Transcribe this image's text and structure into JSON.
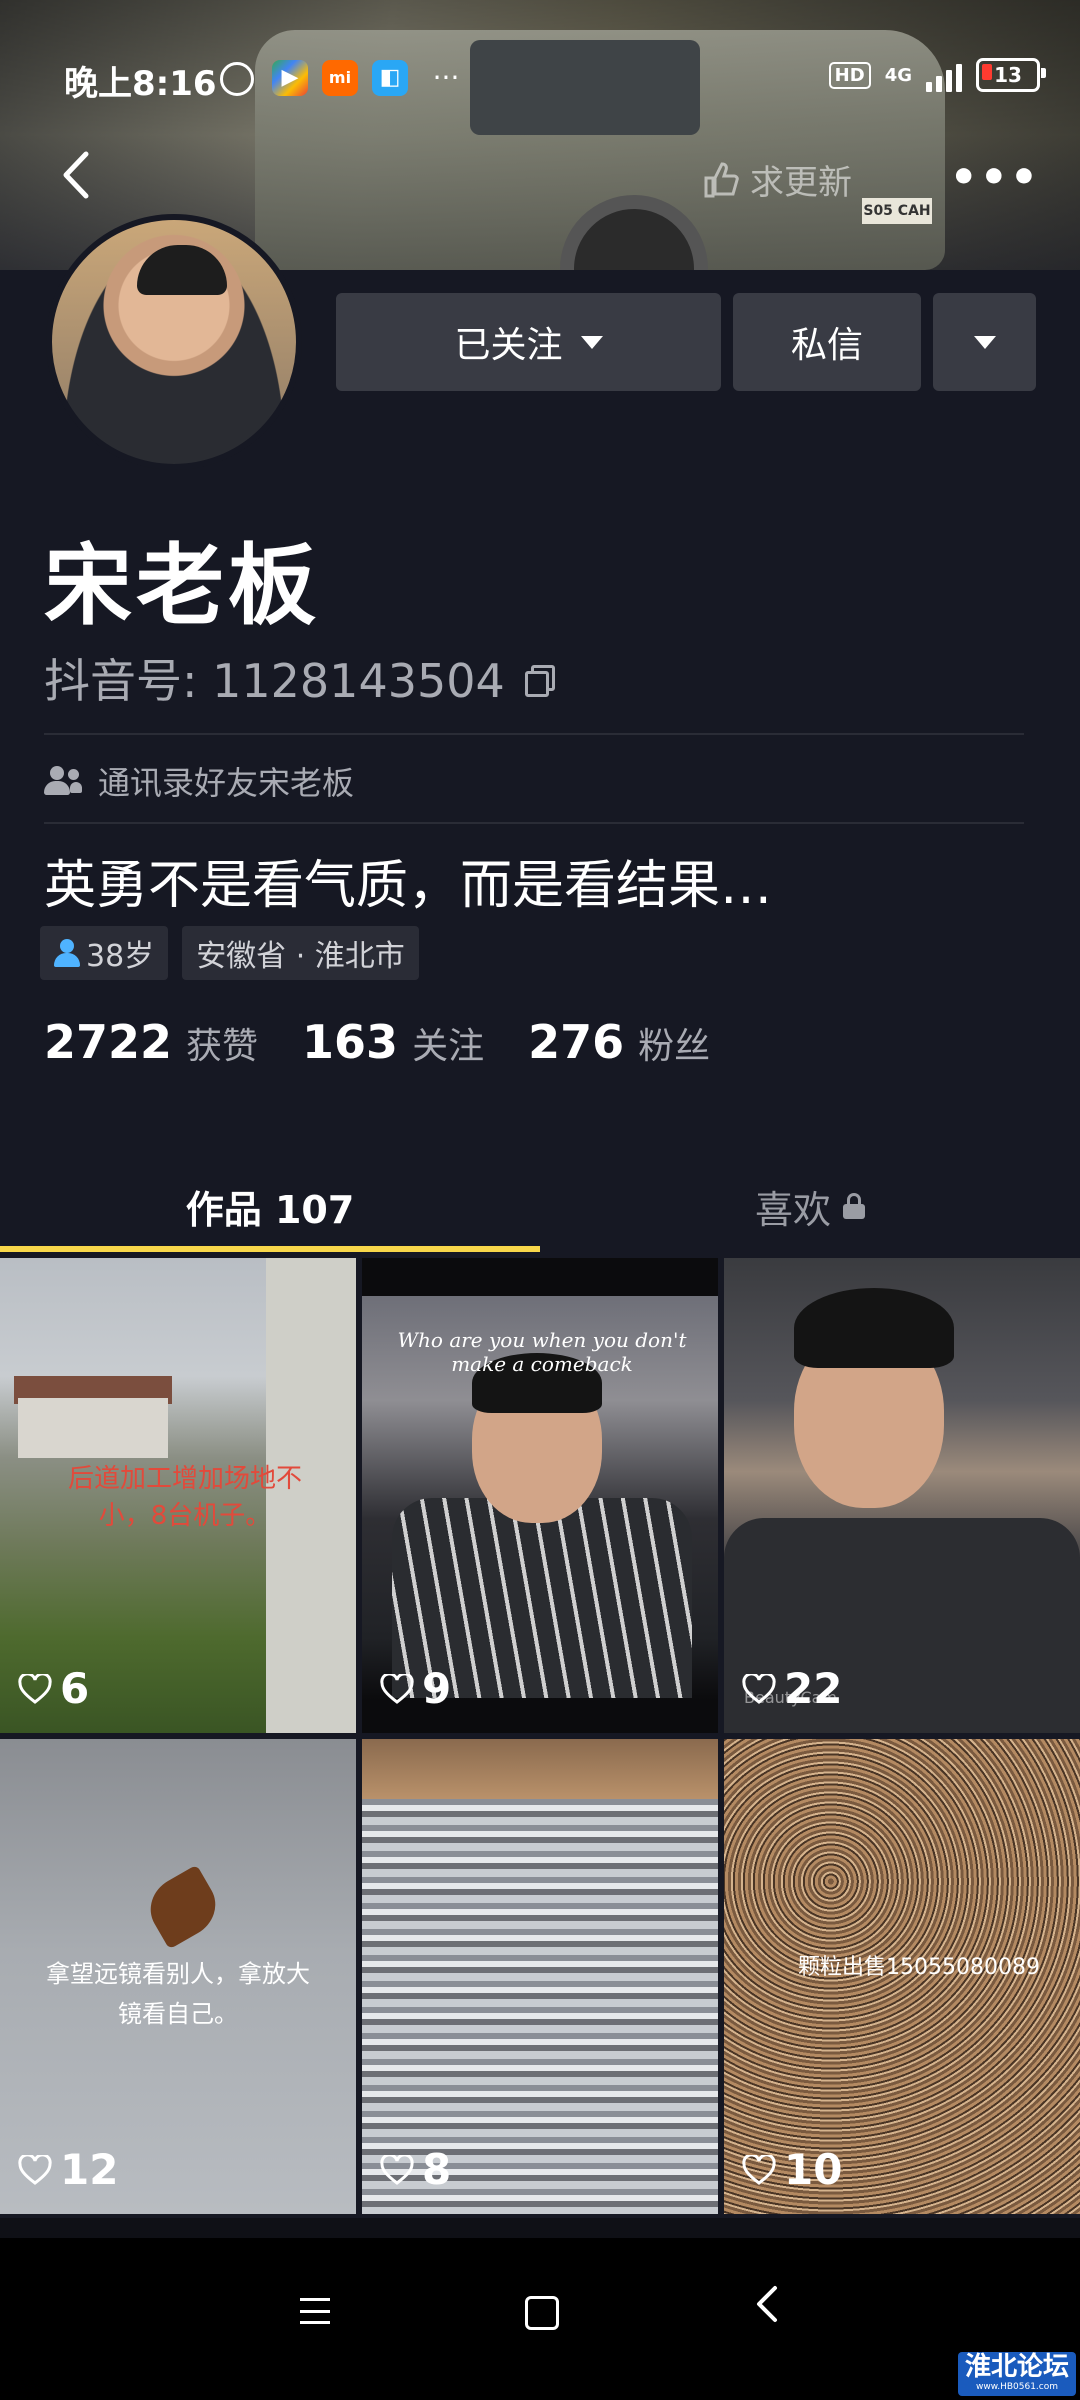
{
  "status_bar": {
    "time": "晚上8:16",
    "network": "4G",
    "hd": "HD",
    "battery": "13"
  },
  "header": {
    "update_label": "求更新"
  },
  "profile": {
    "name": "宋老板",
    "douyin_id": "抖音号: 1128143504",
    "friend_note": "通讯录好友宋老板",
    "bio": "英勇不是看气质，而是看结果…",
    "tags": [
      "38岁",
      "安徽省 · 淮北市"
    ]
  },
  "actions": {
    "follow_label": "已关注",
    "message_label": "私信"
  },
  "stats": [
    {
      "value": "2722",
      "label": "获赞"
    },
    {
      "value": "163",
      "label": "关注"
    },
    {
      "value": "276",
      "label": "粉丝"
    }
  ],
  "tabs": {
    "works": "作品 107",
    "likes": "喜欢"
  },
  "videos": [
    {
      "likes": "6",
      "overlay": "后道加工增加场地不小，8台机子。"
    },
    {
      "likes": "9",
      "overlay": "Who are you when you don't make a comeback"
    },
    {
      "likes": "22",
      "overlay": "BeautyCam"
    },
    {
      "likes": "12",
      "overlay": "拿望远镜看别人，拿放大镜看自己。"
    },
    {
      "likes": "8",
      "overlay": ""
    },
    {
      "likes": "10",
      "overlay": "颗粒出售15055080089"
    }
  ],
  "watermark": {
    "title": "淮北论坛",
    "url": "www.HB0561.com"
  },
  "colors": {
    "background": "#161823",
    "button": "#393b44",
    "accent_underline": "#f8d74a",
    "secondary_text": "#a9abb3"
  }
}
